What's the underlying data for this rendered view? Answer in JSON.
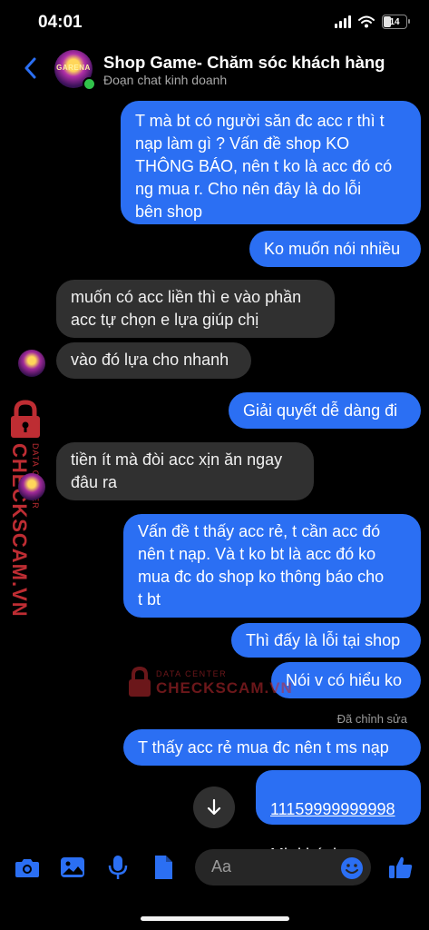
{
  "status": {
    "time": "04:01",
    "battery": "14"
  },
  "header": {
    "title": "Shop Game- Chăm sóc khách hàng",
    "subtitle": "Đoạn chat kinh doanh",
    "avatar_text": "GARENA"
  },
  "messages": [
    {
      "text": "T mà bt có người săn đc acc r thì t\nnạp làm gì ? Vấn đề shop KO\nTHÔNG BÁO, nên t ko là acc đó có\nng mua r. Cho nên đây là do lỗi\nbên shop"
    },
    {
      "text": "Ko muốn nói nhiều"
    },
    {
      "text": "muốn có acc liền thì e vào phần\nacc tự chọn e lựa giúp chị"
    },
    {
      "text": "vào đó lựa cho nhanh"
    },
    {
      "text": "Giải quyết dễ dàng đi"
    },
    {
      "text": "tiền ít mà đòi acc xịn ăn ngay\nđâu ra"
    },
    {
      "text": "Vấn đề t thấy acc rẻ, t cần acc đó\nnên t nạp. Và t ko bt là acc đó ko\nmua đc do shop ko thông báo cho\nt bt"
    },
    {
      "text": "Thì đấy là lỗi tại shop"
    },
    {
      "text": "Nói v có hiểu ko"
    },
    {
      "text": "T thấy acc rẻ mua đc nên t ms nạp"
    },
    {
      "link": "11159999999998",
      "text": "Mb khánh"
    }
  ],
  "edited_label": "Đã chỉnh sửa",
  "watermark": {
    "small": "DATA CENTER",
    "brand": "CHECKSCAM.VN"
  },
  "composer": {
    "placeholder": "Aa"
  },
  "colors": {
    "outgoing": "#2b6ff3",
    "incoming": "#303030",
    "accent": "#2b6ff3",
    "watermark": "#e0353c"
  },
  "icons": [
    "back-chevron-icon",
    "camera-icon",
    "image-icon",
    "microphone-icon",
    "file-icon",
    "emoji-icon",
    "thumbs-up-icon",
    "arrow-down-icon"
  ]
}
